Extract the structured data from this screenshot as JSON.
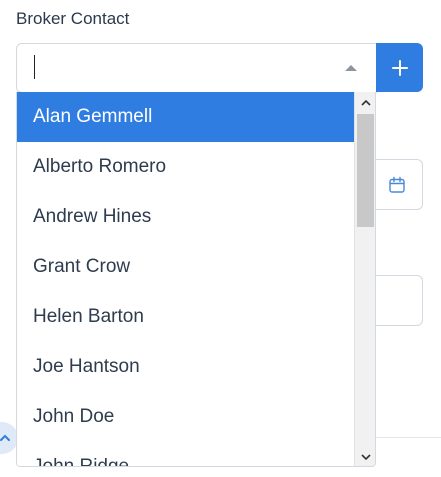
{
  "field": {
    "label": "Broker Contact",
    "value": "",
    "add_label": "+"
  },
  "dropdown": {
    "options": [
      "Alan Gemmell",
      "Alberto Romero",
      "Andrew Hines",
      "Grant Crow",
      "Helen Barton",
      "Joe Hantson",
      "John Doe",
      "John Ridge"
    ],
    "selected_index": 0
  },
  "colors": {
    "accent": "#2f7de1",
    "border": "#d3d9e0"
  }
}
